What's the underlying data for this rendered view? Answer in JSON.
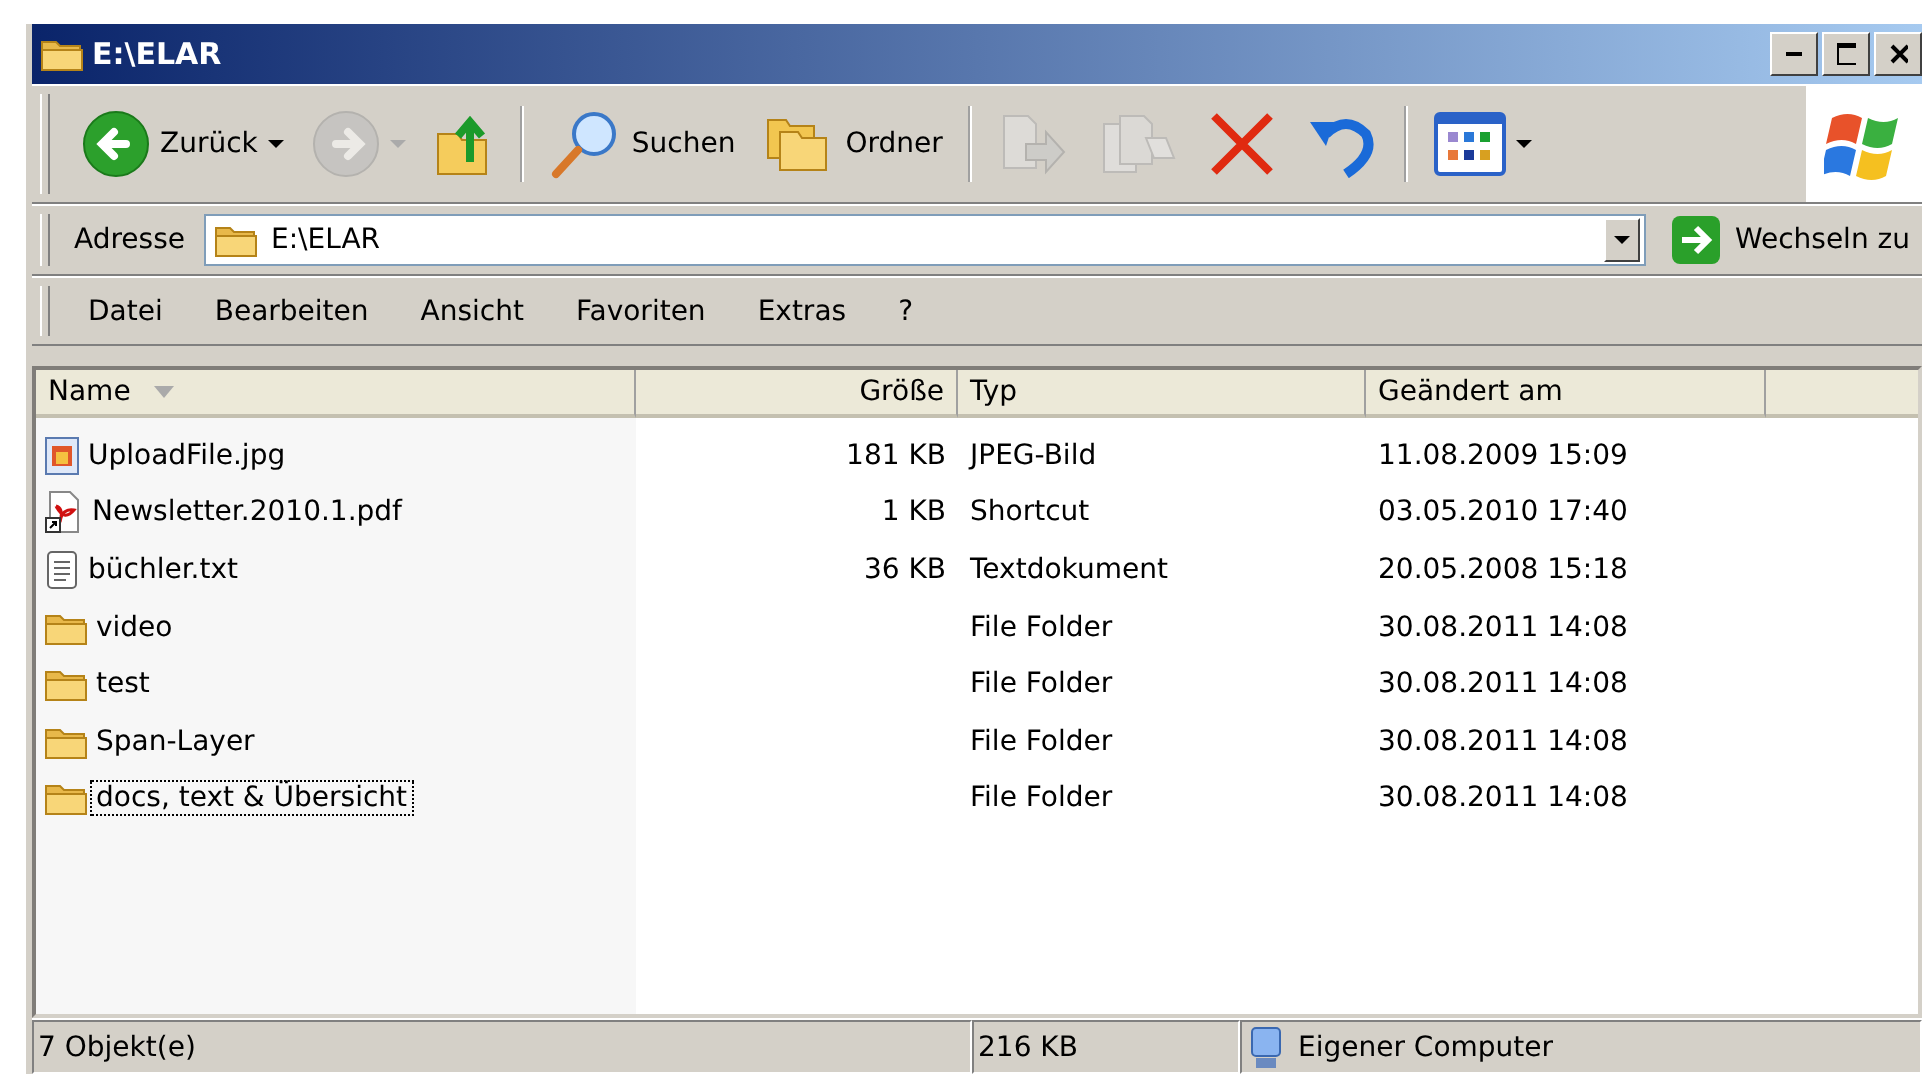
{
  "window": {
    "title": "E:\\ELAR"
  },
  "toolbar": [
    {
      "kind": "back",
      "label": "Zurück",
      "dropdown": true,
      "disabled": false
    },
    {
      "kind": "forward",
      "dropdown": true,
      "disabled": true
    },
    {
      "kind": "up",
      "disabled": false
    },
    {
      "kind": "search",
      "label": "Suchen",
      "disabled": false
    },
    {
      "kind": "folders",
      "label": "Ordner",
      "disabled": false
    },
    {
      "kind": "move",
      "disabled": true
    },
    {
      "kind": "copy",
      "disabled": true
    },
    {
      "kind": "delete",
      "disabled": false
    },
    {
      "kind": "undo",
      "disabled": false
    },
    {
      "kind": "views",
      "dropdown": true,
      "disabled": false
    }
  ],
  "address": {
    "label": "Adresse",
    "value": "E:\\ELAR",
    "go": "Wechseln zu"
  },
  "menu": [
    "Datei",
    "Bearbeiten",
    "Ansicht",
    "Favoriten",
    "Extras",
    "?"
  ],
  "table": {
    "columns": [
      {
        "label": "Name",
        "sorted": true
      },
      {
        "label": "Größe",
        "sorted": false
      },
      {
        "label": "Typ",
        "sorted": false
      },
      {
        "label": "Geändert am",
        "sorted": false
      }
    ],
    "rows": [
      {
        "kind": "image",
        "name": "UploadFile.jpg",
        "size": "181 KB",
        "type": "JPEG-Bild",
        "modified": "11.08.2009 15:09",
        "focused": false
      },
      {
        "kind": "pdf",
        "name": "Newsletter.2010.1.pdf",
        "size": "1 KB",
        "type": "Shortcut",
        "modified": "03.05.2010 17:40",
        "focused": false
      },
      {
        "kind": "text",
        "name": "büchler.txt",
        "size": "36 KB",
        "type": "Textdokument",
        "modified": "20.05.2008 15:18",
        "focused": false
      },
      {
        "kind": "folder",
        "name": "video",
        "type": "File Folder",
        "modified": "30.08.2011 14:08",
        "focused": false
      },
      {
        "kind": "folder",
        "name": "test",
        "type": "File Folder",
        "modified": "30.08.2011 14:08",
        "focused": false
      },
      {
        "kind": "folder",
        "name": "Span-Layer",
        "type": "File Folder",
        "modified": "30.08.2011 14:08",
        "focused": false
      },
      {
        "kind": "folder",
        "name": "docs, text & Übersicht",
        "type": "File Folder",
        "modified": "30.08.2011 14:08",
        "focused": true
      }
    ]
  },
  "status_bar": {
    "count": "7 Objekt(e)",
    "size": "216 KB",
    "zone": "Eigener Computer"
  }
}
